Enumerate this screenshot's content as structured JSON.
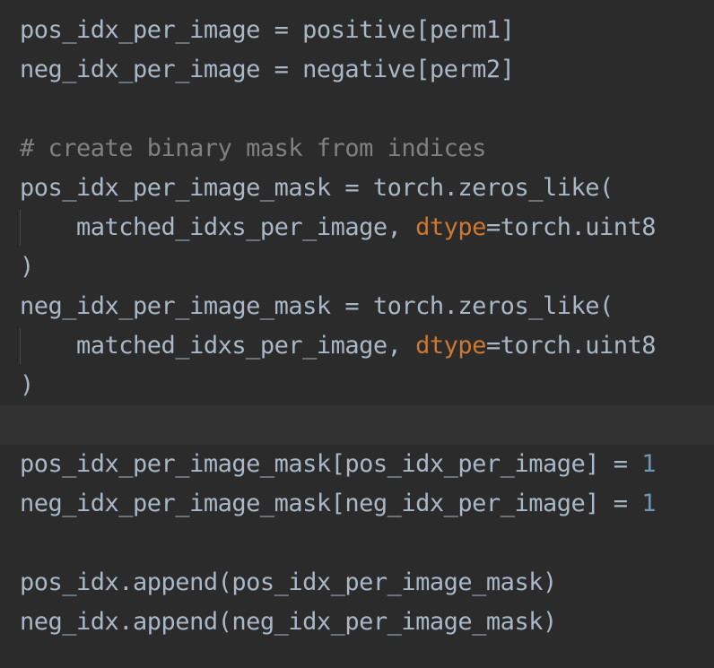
{
  "editor": {
    "language": "python",
    "background_color": "#2b2b2b",
    "highlight_line_color": "#323232",
    "indent_guide_color": "#4a4a4a",
    "colors": {
      "default": "#a9b7c6",
      "comment": "#808080",
      "keyword": "#cc7832",
      "number": "#6897bb"
    },
    "lines": [
      {
        "indent_guide": false,
        "highlighted": false,
        "tokens": [
          {
            "text": "pos_idx_per_image = positive[perm1]",
            "kind": "default"
          }
        ]
      },
      {
        "indent_guide": false,
        "highlighted": false,
        "tokens": [
          {
            "text": "neg_idx_per_image = negative[perm2]",
            "kind": "default"
          }
        ]
      },
      {
        "indent_guide": false,
        "highlighted": false,
        "tokens": []
      },
      {
        "indent_guide": false,
        "highlighted": false,
        "tokens": [
          {
            "text": "# create binary mask from indices",
            "kind": "comment"
          }
        ]
      },
      {
        "indent_guide": false,
        "highlighted": false,
        "tokens": [
          {
            "text": "pos_idx_per_image_mask = torch.zeros_like(",
            "kind": "default"
          }
        ]
      },
      {
        "indent_guide": true,
        "highlighted": false,
        "tokens": [
          {
            "text": "    matched_idxs_per_image, ",
            "kind": "default"
          },
          {
            "text": "dtype",
            "kind": "keyword"
          },
          {
            "text": "=torch.uint8",
            "kind": "default"
          }
        ]
      },
      {
        "indent_guide": false,
        "highlighted": false,
        "tokens": [
          {
            "text": ")",
            "kind": "default"
          }
        ]
      },
      {
        "indent_guide": false,
        "highlighted": false,
        "tokens": [
          {
            "text": "neg_idx_per_image_mask = torch.zeros_like(",
            "kind": "default"
          }
        ]
      },
      {
        "indent_guide": true,
        "highlighted": false,
        "tokens": [
          {
            "text": "    matched_idxs_per_image, ",
            "kind": "default"
          },
          {
            "text": "dtype",
            "kind": "keyword"
          },
          {
            "text": "=torch.uint8",
            "kind": "default"
          }
        ]
      },
      {
        "indent_guide": false,
        "highlighted": false,
        "tokens": [
          {
            "text": ")",
            "kind": "default"
          }
        ]
      },
      {
        "indent_guide": false,
        "highlighted": true,
        "tokens": []
      },
      {
        "indent_guide": false,
        "highlighted": false,
        "tokens": [
          {
            "text": "pos_idx_per_image_mask[pos_idx_per_image] = ",
            "kind": "default"
          },
          {
            "text": "1",
            "kind": "number"
          }
        ]
      },
      {
        "indent_guide": false,
        "highlighted": false,
        "tokens": [
          {
            "text": "neg_idx_per_image_mask[neg_idx_per_image] = ",
            "kind": "default"
          },
          {
            "text": "1",
            "kind": "number"
          }
        ]
      },
      {
        "indent_guide": false,
        "highlighted": false,
        "tokens": []
      },
      {
        "indent_guide": false,
        "highlighted": false,
        "tokens": [
          {
            "text": "pos_idx.append(pos_idx_per_image_mask)",
            "kind": "default"
          }
        ]
      },
      {
        "indent_guide": false,
        "highlighted": false,
        "tokens": [
          {
            "text": "neg_idx.append(neg_idx_per_image_mask)",
            "kind": "default"
          }
        ]
      }
    ]
  }
}
